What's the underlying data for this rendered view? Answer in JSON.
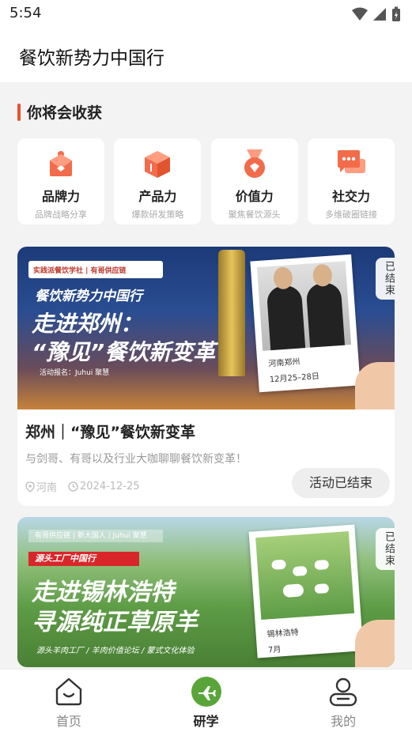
{
  "status_bar": {
    "time": "5:54"
  },
  "header": {
    "title": "餐饮新势力中国行"
  },
  "section": {
    "title": "你将会收获"
  },
  "features": [
    {
      "label": "品牌力",
      "sub": "品牌战略分享",
      "icon": "gift-box-icon"
    },
    {
      "label": "产品力",
      "sub": "爆款研发策略",
      "icon": "product-cube-icon"
    },
    {
      "label": "价值力",
      "sub": "聚焦餐饮源头",
      "icon": "medal-icon"
    },
    {
      "label": "社交力",
      "sub": "多维破圈链接",
      "icon": "chat-bubble-icon"
    }
  ],
  "events": [
    {
      "badge": "已结束",
      "banner": {
        "logos": "实践派餐饮学社 | 有哥供应链",
        "subtitle": "餐饮新势力中国行",
        "headline1": "走进郑州：",
        "headline2": "“豫见”餐饮新变革",
        "small": "活动报名：Juhui 聚慧",
        "photo_line1": "河南郑州",
        "photo_line2": "12月25–28日"
      },
      "title": "郑州｜“豫见”餐饮新变革",
      "desc": "与剑哥、有哥以及行业大咖聊聊餐饮新变革！",
      "location": "河南",
      "date": "2024-12-25",
      "status": "活动已结束"
    },
    {
      "badge": "已结束",
      "banner": {
        "logos": "有哥供应链 | 新大国人 | Juhui 聚慧",
        "red_tag": "源头工厂中国行",
        "headline1": "走进锡林浩特",
        "headline2": "寻源纯正草原羊",
        "small": "源头羊肉工厂 / 羊肉价值论坛 / 蒙式文化体验",
        "photo_line1": "锡林浩特",
        "photo_line2": "7月"
      }
    }
  ],
  "nav": [
    {
      "label": "首页",
      "icon": "home-icon",
      "active": false
    },
    {
      "label": "研学",
      "icon": "plane-icon",
      "active": true
    },
    {
      "label": "我的",
      "icon": "profile-icon",
      "active": false
    }
  ],
  "colors": {
    "accent": "#e8502f",
    "nav_active": "#5aa53a"
  }
}
